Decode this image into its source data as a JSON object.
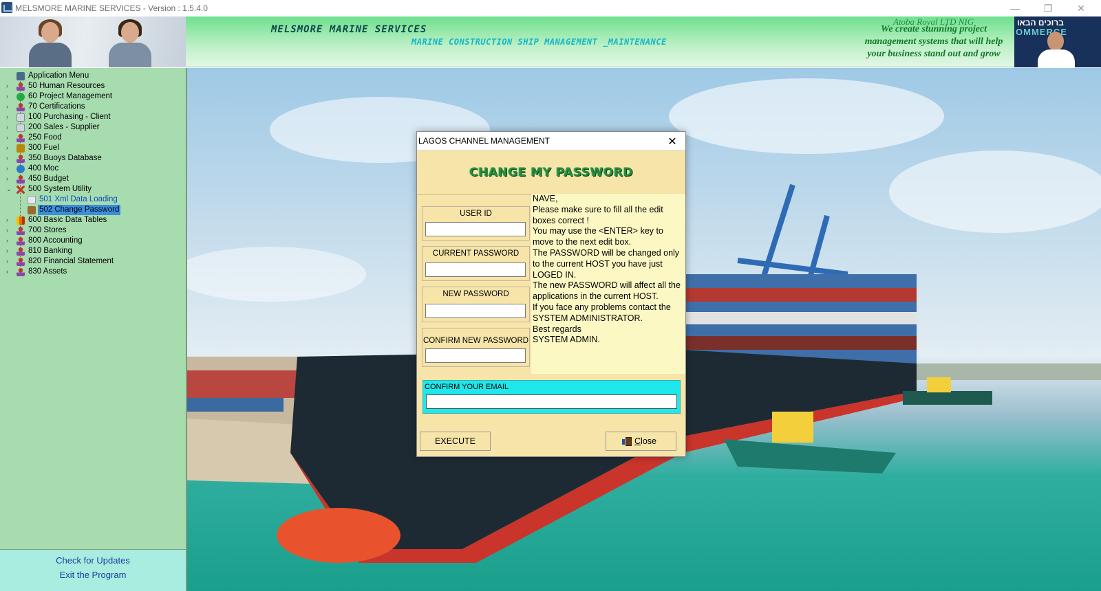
{
  "window": {
    "title": "MELSMORE MARINE SERVICES - Version : 1.5.4.0",
    "minimize_glyph": "—",
    "maximize_glyph": "❐",
    "close_glyph": "✕"
  },
  "header": {
    "company_name": "MELSMORE MARINE SERVICES",
    "tagline": "MARINE CONSTRUCTION SHIP MANAGEMENT _MAINTENANCE",
    "ad_company": "Atoba Royal LTD NIG",
    "ad_slogan": "We create stunning project management systems that will help your business stand out and grow",
    "ad_photo_text_top": "ברוכים הבאו",
    "ad_photo_text_mid": "OMMERCE"
  },
  "sidebar": {
    "tree": [
      {
        "label": "Application Menu",
        "icon": "app-icon",
        "chevron": ""
      },
      {
        "label": "50   Human Resources",
        "icon": "person-icon",
        "chevron": "›"
      },
      {
        "label": "60   Project Management",
        "icon": "green-circle-icon",
        "chevron": "›"
      },
      {
        "label": "70   Certifications",
        "icon": "person-icon",
        "chevron": "›"
      },
      {
        "label": "100   Purchasing  - Client",
        "icon": "cart-icon",
        "chevron": "›"
      },
      {
        "label": "200   Sales - Supplier",
        "icon": "cart-icon",
        "chevron": "›"
      },
      {
        "label": "250   Food",
        "icon": "person-icon",
        "chevron": "›"
      },
      {
        "label": "300   Fuel",
        "icon": "fuel-icon",
        "chevron": "›"
      },
      {
        "label": "350   Buoys Database",
        "icon": "person-icon",
        "chevron": "›"
      },
      {
        "label": "400   Moc",
        "icon": "moc-icon",
        "chevron": "›"
      },
      {
        "label": "450   Budget",
        "icon": "person-icon",
        "chevron": "›"
      },
      {
        "label": "500   System Utility",
        "icon": "tools-icon",
        "chevron": "⌄"
      },
      {
        "label": "501   Xml Data Loading",
        "icon": "xml-icon",
        "sub": true
      },
      {
        "label": "502   Change Password",
        "icon": "key-icon",
        "sub": true,
        "selected": true
      },
      {
        "label": "600   Basic  Data Tables",
        "icon": "chart-icon",
        "chevron": "›"
      },
      {
        "label": "700   Stores",
        "icon": "person-icon",
        "chevron": "›"
      },
      {
        "label": "800   Accounting",
        "icon": "person-icon",
        "chevron": "›"
      },
      {
        "label": "810   Banking",
        "icon": "person-icon",
        "chevron": "›"
      },
      {
        "label": "820   Financial Statement",
        "icon": "person-icon",
        "chevron": "›"
      },
      {
        "label": "830   Assets",
        "icon": "person-icon",
        "chevron": "›"
      }
    ],
    "check_updates": "Check for Updates",
    "exit_program": "Exit the Program"
  },
  "dialog": {
    "title": "LAGOS CHANNEL MANAGEMENT",
    "close_glyph": "✕",
    "heading": "CHANGE MY PASSWORD",
    "user_id_label": "USER ID",
    "user_id_value": "",
    "current_password_label": "CURRENT PASSWORD",
    "current_password_value": "",
    "new_password_label": "NEW PASSWORD",
    "new_password_value": "",
    "confirm_new_password_label": "CONFIRM NEW PASSWORD",
    "confirm_new_password_value": "",
    "info_text": "NAVE,\nPlease make sure to fill all the edit boxes correct !\nYou may use the <ENTER> key to move to the next edit box.\nThe PASSWORD will be changed only to the current HOST you have just LOGED IN.\nThe new PASSWORD will affect all the applications in the current HOST.\nIf you face any problems contact the SYSTEM ADMINISTRATOR.\nBest regards\nSYSTEM ADMIN.",
    "email_label": "CONFIRM YOUR EMAIL",
    "email_value": "",
    "execute_label": "EXECUTE",
    "close_label_prefix": "",
    "close_label_u": "C",
    "close_label_rest": "lose"
  },
  "colors": {
    "sidebar_bg": "#a6dcae",
    "dialog_bg": "#f6e4a8",
    "info_bg": "#fcf8c4",
    "email_bg": "#1ee8ec",
    "heading_green": "#2b8a3e",
    "selected_item": "#3b8fd9"
  }
}
